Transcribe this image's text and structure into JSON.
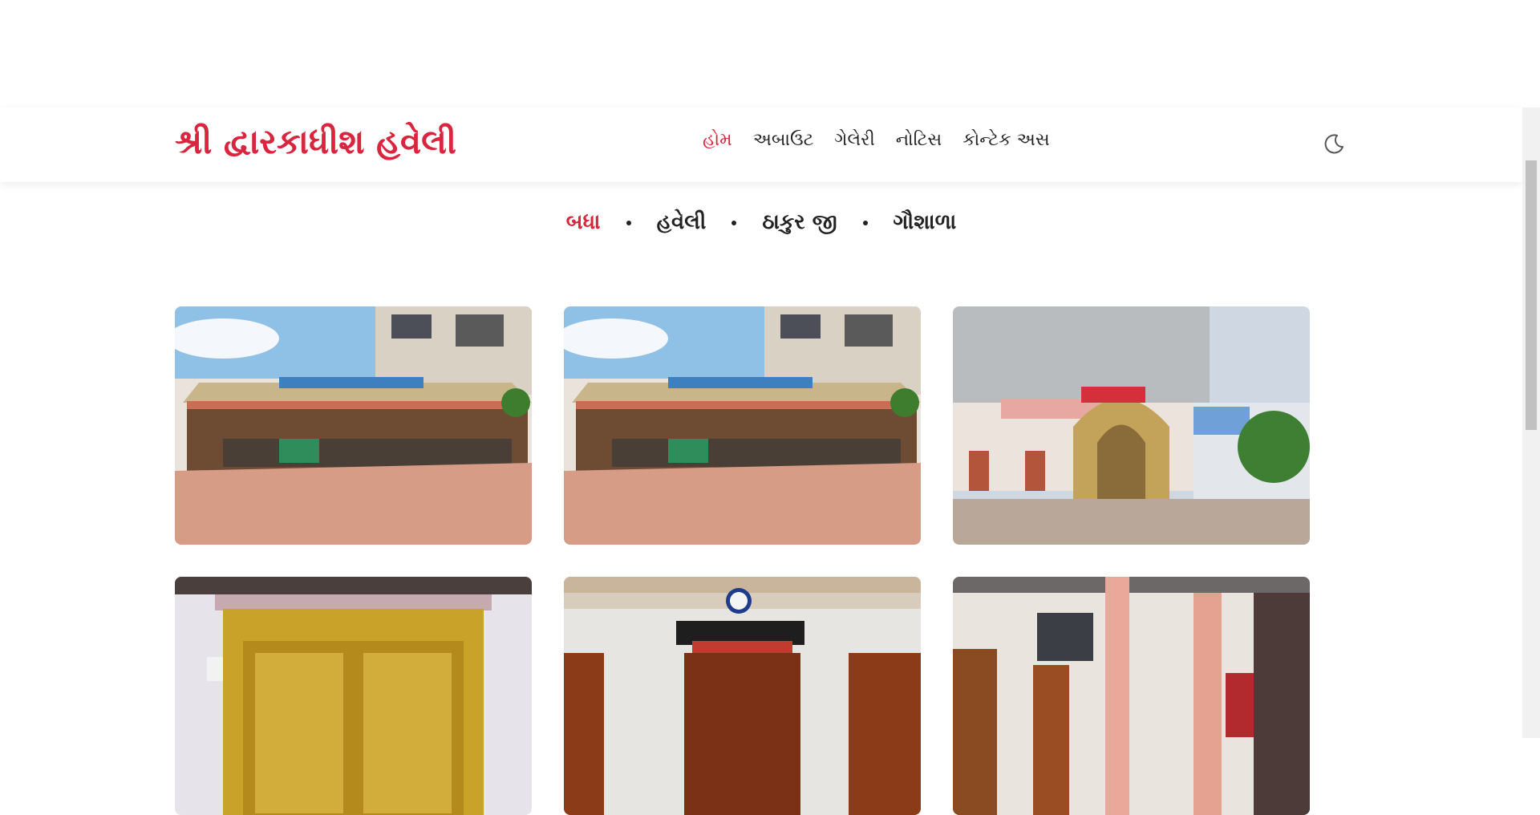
{
  "site": {
    "title": "શ્રી દ્વારકાધીશ હવેલી"
  },
  "nav": {
    "items": [
      {
        "label": "હોમ",
        "active": true
      },
      {
        "label": "અબાઉટ",
        "active": false
      },
      {
        "label": "ગેલેરી",
        "active": false
      },
      {
        "label": "નોટિસ",
        "active": false
      },
      {
        "label": "કોન્ટેક અસ",
        "active": false
      }
    ]
  },
  "theme_toggle": {
    "icon": "moon-icon"
  },
  "filters": {
    "items": [
      {
        "label": "બધા",
        "active": true
      },
      {
        "label": "હવેલી",
        "active": false
      },
      {
        "label": "ઠાકુર જી",
        "active": false
      },
      {
        "label": "ગૌશાળા",
        "active": false
      }
    ]
  },
  "colors": {
    "accent": "#d9253d",
    "text": "#222222"
  }
}
